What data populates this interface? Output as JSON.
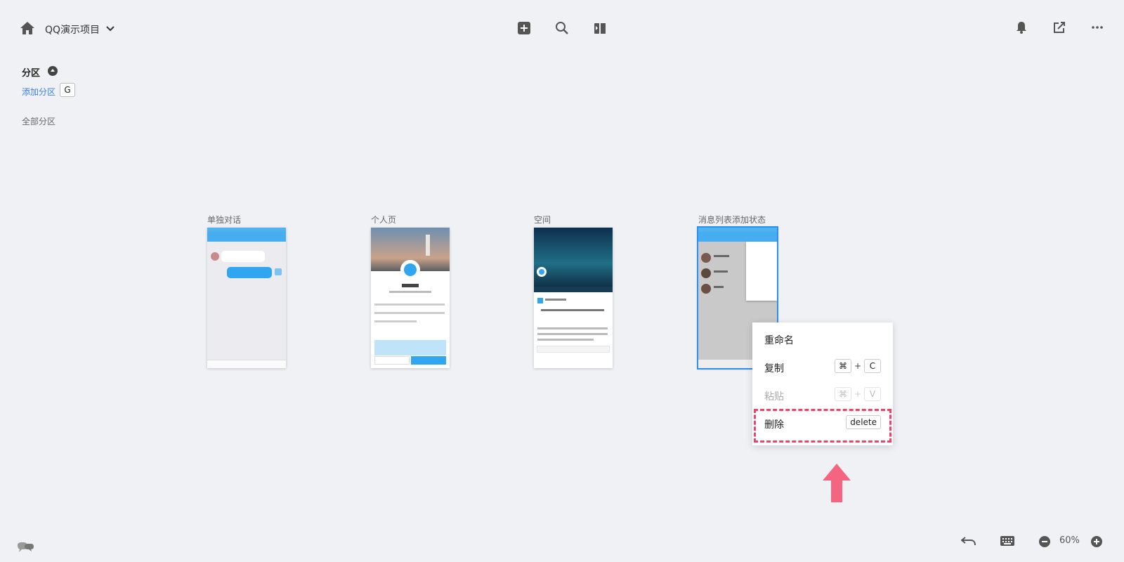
{
  "header": {
    "project_name": "QQ演示项目",
    "icons": [
      "home-icon",
      "chevron-down-icon",
      "add-square-icon",
      "search-icon",
      "prototype-play-icon",
      "bell-icon",
      "share-icon",
      "more-icon"
    ]
  },
  "sections": {
    "title": "分区",
    "add_label": "添加分区",
    "add_shortcut": "G",
    "all_label": "全部分区"
  },
  "screens": [
    {
      "label": "单独对话"
    },
    {
      "label": "个人页"
    },
    {
      "label": "空间"
    },
    {
      "label": "消息列表添加状态"
    }
  ],
  "context_menu": {
    "rename": "重命名",
    "copy": "复制",
    "copy_keys": [
      "⌘",
      "+",
      "C"
    ],
    "paste": "粘贴",
    "paste_keys": [
      "⌘",
      "+",
      "V"
    ],
    "delete": "删除",
    "delete_key": "delete"
  },
  "footer": {
    "zoom": "60%"
  },
  "colors": {
    "accent_link": "#3b7ee9",
    "highlight_dash": "#f0436a",
    "arrow": "#f36580",
    "selected_outline": "#2e8ff0"
  }
}
